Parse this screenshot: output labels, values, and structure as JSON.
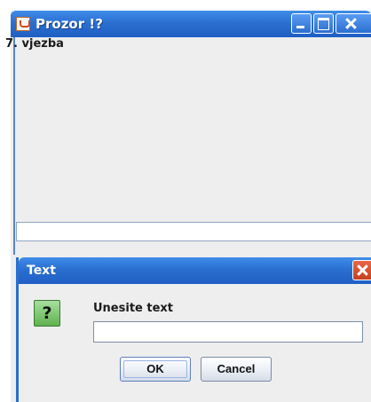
{
  "main_window": {
    "title": "Prozor !?",
    "label": "7. vjezba",
    "input_value": ""
  },
  "dialog": {
    "title": "Text",
    "icon": "question-icon",
    "prompt": "Unesite text",
    "input_value": "",
    "ok_label": "OK",
    "cancel_label": "Cancel"
  },
  "colors": {
    "titlebar": "#2b6fd0",
    "close_button": "#c4401f",
    "background": "#eeeeee"
  }
}
